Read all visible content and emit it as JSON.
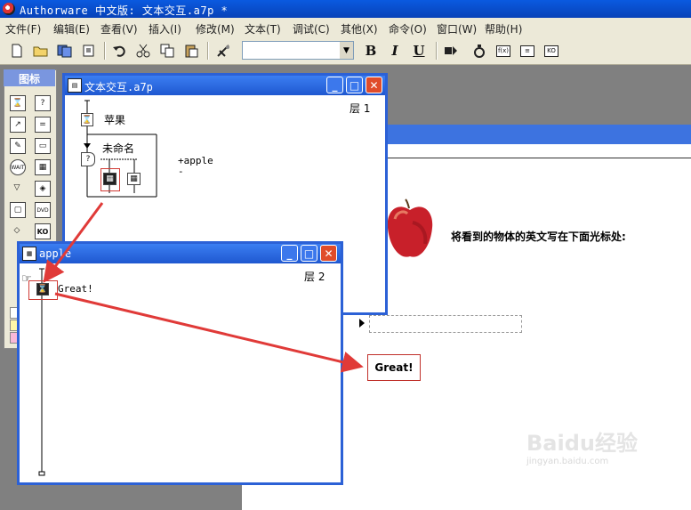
{
  "app": {
    "title": "Authorware 中文版: 文本交互.a7p *"
  },
  "menu": [
    "文件(F)",
    "编辑(E)",
    "查看(V)",
    "插入(I)",
    "修改(M)",
    "文本(T)",
    "调试(C)",
    "其他(X)",
    "命令(O)",
    "窗口(W)",
    "帮助(H)"
  ],
  "toolbar": {
    "bold": "B",
    "italic": "I",
    "underline": "U",
    "style_value": "",
    "style_arrow": "▼"
  },
  "palette": {
    "title": "图标",
    "wait_label": "WAIT",
    "dvd_label": "DVD",
    "ko_label": "KO"
  },
  "main_window": {
    "title": "文本交互.a7p",
    "level": "层 1",
    "icon_apple": "苹果",
    "interaction_label": "未命名",
    "response_label": "+apple",
    "response_dash": "-"
  },
  "sub_window": {
    "title": "apple",
    "level": "层 2",
    "icon_label": "Great!"
  },
  "presentation": {
    "instruction": "将看到的物体的英文写在下面光标处:",
    "feedback": "Great!"
  },
  "watermark": {
    "brand": "Baidu经验",
    "url": "jingyan.baidu.com"
  },
  "colors": {
    "xp_blue": "#2c61d6",
    "highlight_red": "#d03a34",
    "apple_red": "#c8202a"
  }
}
